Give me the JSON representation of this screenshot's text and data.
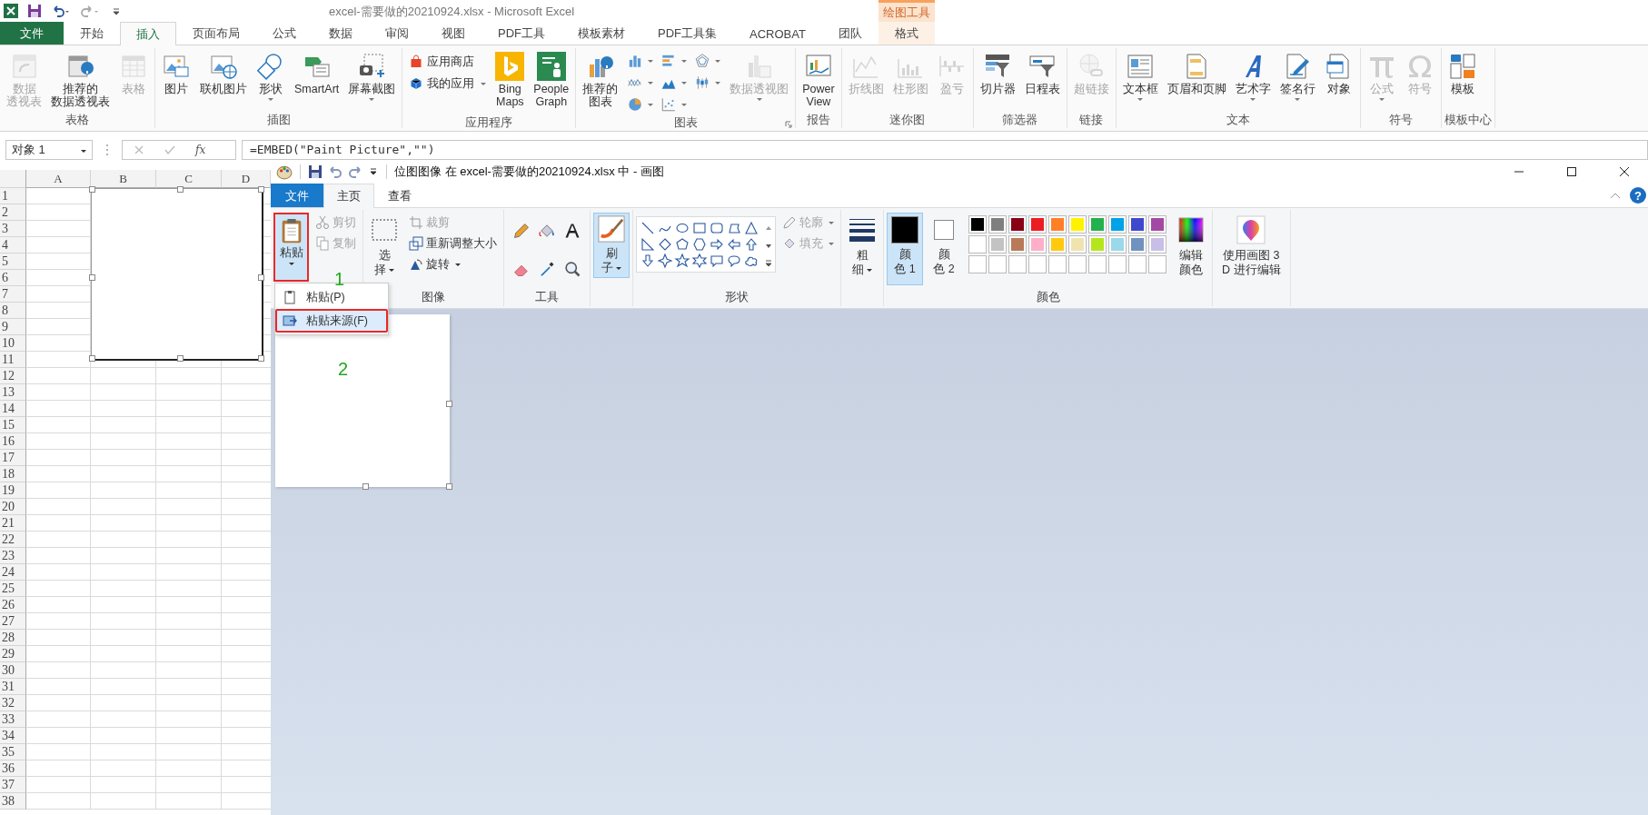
{
  "excel": {
    "title": "excel-需要做的20210924.xlsx - Microsoft Excel",
    "context_group": "绘图工具",
    "tabs": [
      {
        "label": "文件",
        "kind": "file",
        "selected": false
      },
      {
        "label": "开始",
        "kind": "normal",
        "selected": false
      },
      {
        "label": "插入",
        "kind": "normal",
        "selected": true
      },
      {
        "label": "页面布局",
        "kind": "normal",
        "selected": false
      },
      {
        "label": "公式",
        "kind": "normal",
        "selected": false
      },
      {
        "label": "数据",
        "kind": "normal",
        "selected": false
      },
      {
        "label": "审阅",
        "kind": "normal",
        "selected": false
      },
      {
        "label": "视图",
        "kind": "normal",
        "selected": false
      },
      {
        "label": "PDF工具",
        "kind": "normal",
        "selected": false
      },
      {
        "label": "模板素材",
        "kind": "normal",
        "selected": false
      },
      {
        "label": "PDF工具集",
        "kind": "normal",
        "selected": false
      },
      {
        "label": "ACROBAT",
        "kind": "normal",
        "selected": false
      },
      {
        "label": "团队",
        "kind": "normal",
        "selected": false
      },
      {
        "label": "格式",
        "kind": "context",
        "selected": false
      }
    ],
    "ribbon": [
      {
        "label": "表格",
        "dialog_launcher": false,
        "items": [
          {
            "kind": "large",
            "lines": [
              "数据",
              "透视表"
            ],
            "disabled": true,
            "dropdown": false
          },
          {
            "kind": "large",
            "lines": [
              "推荐的",
              "数据透视表"
            ],
            "disabled": false,
            "dropdown": false
          },
          {
            "kind": "large",
            "lines": [
              "表格"
            ],
            "disabled": true,
            "dropdown": false
          }
        ]
      },
      {
        "label": "插图",
        "dialog_launcher": false,
        "items": [
          {
            "kind": "large",
            "lines": [
              "图片"
            ],
            "disabled": false,
            "dropdown": false
          },
          {
            "kind": "large",
            "lines": [
              "联机图片"
            ],
            "disabled": false,
            "dropdown": false
          },
          {
            "kind": "large",
            "lines": [
              "形状"
            ],
            "disabled": false,
            "dropdown": true
          },
          {
            "kind": "large",
            "lines": [
              "SmartArt"
            ],
            "disabled": false,
            "dropdown": false
          },
          {
            "kind": "large",
            "lines": [
              "屏幕截图"
            ],
            "disabled": false,
            "dropdown": true
          }
        ]
      },
      {
        "label": "应用程序",
        "dialog_launcher": false,
        "items": [
          {
            "kind": "stack",
            "items": [
              {
                "kind": "small",
                "label": "应用商店",
                "disabled": false,
                "dropdown": false
              },
              {
                "kind": "small",
                "label": "我的应用",
                "disabled": false,
                "dropdown": true
              }
            ]
          },
          {
            "kind": "large",
            "lines": [
              "Bing",
              "Maps"
            ],
            "disabled": false,
            "dropdown": false
          },
          {
            "kind": "large",
            "lines": [
              "People",
              "Graph"
            ],
            "disabled": false,
            "dropdown": false
          }
        ]
      },
      {
        "label": "图表",
        "dialog_launcher": true,
        "items": [
          {
            "kind": "large",
            "lines": [
              "推荐的",
              "图表"
            ],
            "disabled": false,
            "dropdown": false
          },
          {
            "kind": "stack",
            "items": [
              {
                "kind": "icon",
                "disabled": false,
                "dropdown": true
              },
              {
                "kind": "icon",
                "disabled": false,
                "dropdown": true
              },
              {
                "kind": "icon",
                "disabled": false,
                "dropdown": true
              },
              {
                "kind": "icon",
                "disabled": false,
                "dropdown": true
              },
              {
                "kind": "icon",
                "disabled": false,
                "dropdown": true
              },
              {
                "kind": "icon",
                "disabled": false,
                "dropdown": true
              },
              {
                "kind": "icon",
                "disabled": false,
                "dropdown": true
              },
              {
                "kind": "icon",
                "disabled": false,
                "dropdown": true
              }
            ]
          },
          {
            "kind": "large",
            "lines": [
              "数据透视图"
            ],
            "disabled": true,
            "dropdown": true
          }
        ]
      },
      {
        "label": "报告",
        "dialog_launcher": false,
        "items": [
          {
            "kind": "large",
            "lines": [
              "Power",
              "View"
            ],
            "disabled": false,
            "dropdown": false
          }
        ]
      },
      {
        "label": "迷你图",
        "dialog_launcher": false,
        "items": [
          {
            "kind": "large",
            "lines": [
              "折线图"
            ],
            "disabled": true,
            "dropdown": false
          },
          {
            "kind": "large",
            "lines": [
              "柱形图"
            ],
            "disabled": true,
            "dropdown": false
          },
          {
            "kind": "large",
            "lines": [
              "盈亏"
            ],
            "disabled": true,
            "dropdown": false
          }
        ]
      },
      {
        "label": "筛选器",
        "dialog_launcher": false,
        "items": [
          {
            "kind": "large",
            "lines": [
              "切片器"
            ],
            "disabled": false,
            "dropdown": false
          },
          {
            "kind": "large",
            "lines": [
              "日程表"
            ],
            "disabled": false,
            "dropdown": false
          }
        ]
      },
      {
        "label": "链接",
        "dialog_launcher": false,
        "items": [
          {
            "kind": "large",
            "lines": [
              "超链接"
            ],
            "disabled": true,
            "dropdown": false
          }
        ]
      },
      {
        "label": "文本",
        "dialog_launcher": false,
        "items": [
          {
            "kind": "large",
            "lines": [
              "文本框"
            ],
            "disabled": false,
            "dropdown": true
          },
          {
            "kind": "large",
            "lines": [
              "页眉和页脚"
            ],
            "disabled": false,
            "dropdown": false
          },
          {
            "kind": "large",
            "lines": [
              "艺术字"
            ],
            "disabled": false,
            "dropdown": true
          },
          {
            "kind": "large",
            "lines": [
              "签名行"
            ],
            "disabled": false,
            "dropdown": true
          },
          {
            "kind": "large",
            "lines": [
              "对象"
            ],
            "disabled": false,
            "dropdown": false
          }
        ]
      },
      {
        "label": "符号",
        "dialog_launcher": false,
        "items": [
          {
            "kind": "large",
            "lines": [
              "公式"
            ],
            "disabled": true,
            "dropdown": true
          },
          {
            "kind": "large",
            "lines": [
              "符号"
            ],
            "disabled": true,
            "dropdown": false
          }
        ]
      },
      {
        "label": "模板中心",
        "dialog_launcher": false,
        "items": [
          {
            "kind": "large",
            "lines": [
              "模板"
            ],
            "disabled": false,
            "dropdown": false
          }
        ]
      }
    ],
    "name_box": "对象 1",
    "fx": "fx",
    "formula": "=EMBED(\"Paint Picture\",\"\")",
    "columns": [
      "A",
      "B",
      "C",
      "D"
    ],
    "rows": [
      "1",
      "2",
      "3",
      "4",
      "5",
      "6",
      "7",
      "8",
      "9",
      "10",
      "11",
      "12",
      "13",
      "14",
      "15",
      "16",
      "17",
      "18",
      "19",
      "20",
      "21",
      "22",
      "23",
      "24",
      "25",
      "26",
      "27",
      "28",
      "29",
      "30",
      "31",
      "32",
      "33",
      "34",
      "35",
      "36",
      "37",
      "38"
    ]
  },
  "paint": {
    "title": "位图图像 在 excel-需要做的20210924.xlsx 中 - 画图",
    "help": "?",
    "tabs": [
      {
        "label": "文件",
        "kind": "file",
        "selected": false
      },
      {
        "label": "主页",
        "kind": "normal",
        "selected": true
      },
      {
        "label": "查看",
        "kind": "normal",
        "selected": false
      }
    ],
    "clipboard": {
      "paste": {
        "label": "粘贴",
        "highlighted": true
      },
      "cut": {
        "label": "剪切",
        "disabled": true
      },
      "copy": {
        "label": "复制",
        "disabled": true
      }
    },
    "image": {
      "label": "图像",
      "select": [
        "选",
        "择"
      ],
      "crop": {
        "label": "裁剪",
        "disabled": true
      },
      "resize": {
        "label": "重新调整大小",
        "disabled": false
      },
      "rotate": {
        "label": "旋转",
        "disabled": false
      }
    },
    "tools": {
      "label": "工具"
    },
    "brushes": {
      "lines": [
        "刷",
        "子"
      ],
      "selected": true
    },
    "shapes": {
      "label": "形状",
      "outline": {
        "label": "轮廓",
        "disabled": true
      },
      "fill": {
        "label": "填充",
        "disabled": true
      }
    },
    "size": {
      "lines": [
        "粗",
        "细"
      ]
    },
    "colors": {
      "label": "颜色",
      "color1": {
        "lines": [
          "颜",
          "色 1"
        ],
        "color": "#000000",
        "selected": true
      },
      "color2": {
        "lines": [
          "颜",
          "色 2"
        ],
        "color": "#ffffff",
        "selected": false
      },
      "palette": [
        {
          "color": "#000000"
        },
        {
          "color": "#7f7f7f"
        },
        {
          "color": "#880015"
        },
        {
          "color": "#ed1c24"
        },
        {
          "color": "#ff7f27"
        },
        {
          "color": "#fff200"
        },
        {
          "color": "#22b14c"
        },
        {
          "color": "#00a2e8"
        },
        {
          "color": "#3f48cc"
        },
        {
          "color": "#a349a4"
        },
        {
          "color": "#ffffff"
        },
        {
          "color": "#c3c3c3"
        },
        {
          "color": "#b97a57"
        },
        {
          "color": "#ffaec9"
        },
        {
          "color": "#ffc90e"
        },
        {
          "color": "#efe4b0"
        },
        {
          "color": "#b5e61d"
        },
        {
          "color": "#99d9ea"
        },
        {
          "color": "#7092be"
        },
        {
          "color": "#c8bfe7"
        }
      ],
      "edit": [
        "编辑",
        "颜色"
      ]
    },
    "paint3d": [
      "使用画图 3",
      "D 进行编辑"
    ],
    "paste_menu": [
      {
        "label": "粘贴(P)",
        "highlighted": false
      },
      {
        "label": "粘贴来源(F)",
        "highlighted": true
      }
    ],
    "step_labels": [
      "1",
      "2"
    ]
  }
}
